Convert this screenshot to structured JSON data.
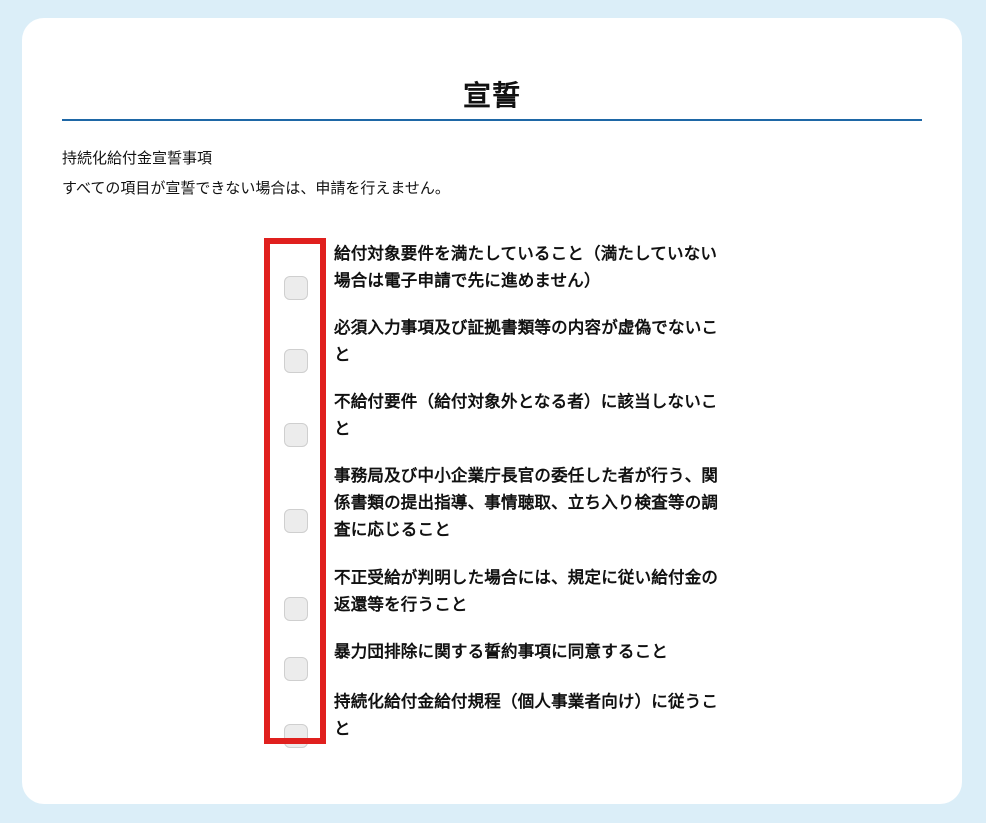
{
  "header": {
    "title": "宣誓",
    "subtitle": "持続化給付金宣誓事項",
    "note": "すべての項目が宣誓できない場合は、申請を行えません。"
  },
  "items": [
    {
      "label": "給付対象要件を満たしていること（満たしていない場合は電子申請で先に進めません）",
      "checked": false
    },
    {
      "label": "必須入力事項及び証拠書類等の内容が虚偽でないこと",
      "checked": false
    },
    {
      "label": "不給付要件（給付対象外となる者）に該当しないこと",
      "checked": false
    },
    {
      "label": "事務局及び中小企業庁長官の委任した者が行う、関係書類の提出指導、事情聴取、立ち入り検査等の調査に応じること",
      "checked": false
    },
    {
      "label": "不正受給が判明した場合には、規定に従い給付金の返還等を行うこと",
      "checked": false
    },
    {
      "label": "暴力団排除に関する誓約事項に同意すること",
      "checked": false
    },
    {
      "label": "持続化給付金給付規程（個人事業者向け）に従うこと",
      "checked": false
    }
  ],
  "colors": {
    "background": "#dbeef8",
    "card": "#ffffff",
    "rule": "#1e67a6",
    "highlight": "#e0201e",
    "checkbox": "#ececec"
  }
}
